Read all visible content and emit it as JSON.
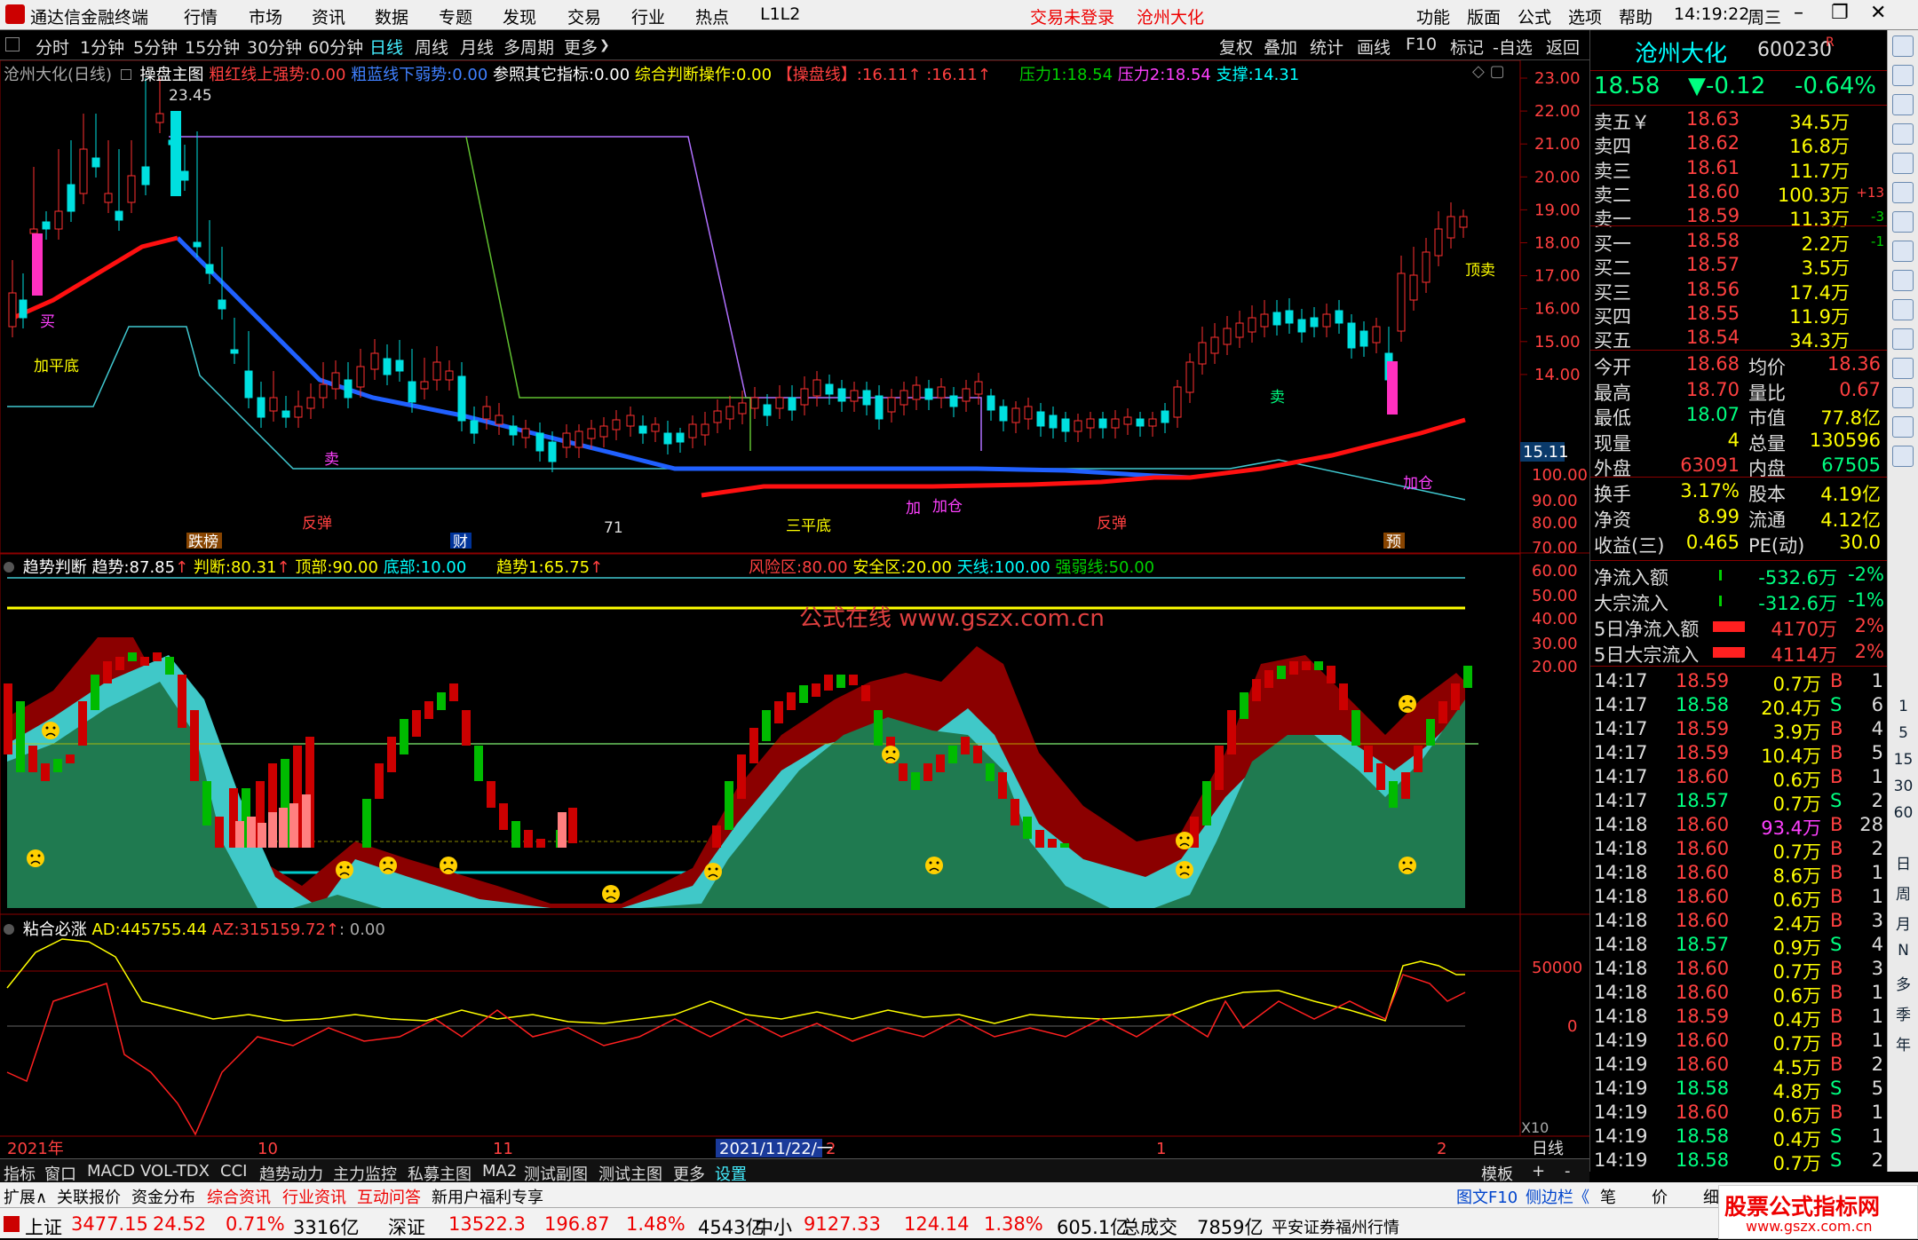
{
  "titlebar": {
    "app_name": "通达信金融终端",
    "menus": [
      "行情",
      "市场",
      "资讯",
      "数据",
      "专题",
      "发现",
      "交易",
      "行业",
      "热点",
      "L1L2"
    ],
    "login_status": "交易未登录",
    "stock_name": "沧州大化",
    "right_menus": [
      "功能",
      "版面",
      "公式",
      "选项",
      "帮助"
    ],
    "time": "14:19:22",
    "weekday": "周三"
  },
  "toolbar": {
    "periods": [
      "分时",
      "1分钟",
      "5分钟",
      "15分钟",
      "30分钟",
      "60分钟",
      "日线",
      "周线",
      "月线",
      "多周期",
      "更多"
    ],
    "active_period": "日线",
    "right_buttons": [
      "复权",
      "叠加",
      "统计",
      "画线",
      "F10",
      "标记",
      "-自选",
      "返回"
    ]
  },
  "main_chart": {
    "title": "沧州大化(日线)",
    "formula": "操盘主图",
    "ind1_label": "粗红线上强势:",
    "ind1_value": "0.00",
    "ind2_label": "粗蓝线下弱势:",
    "ind2_value": "0.00",
    "ind3_label": "参照其它指标:",
    "ind3_value": "0.00",
    "ind4_label": "综合判断操作:",
    "ind4_value": "0.00",
    "ind5_label": "【操盘线】:",
    "ind5_value": "16.11",
    "ind5_value2": "16.11",
    "pressure1_label": "压力1:",
    "pressure1_value": "18.54",
    "pressure2_label": "压力2:",
    "pressure2_value": "18.54",
    "support_label": "支撑:",
    "support_value": "14.31",
    "high_marker": "23.45",
    "price_axis": [
      "23.00",
      "22.00",
      "21.00",
      "20.00",
      "19.00",
      "18.00",
      "17.00",
      "16.00",
      "15.00",
      "14.00"
    ],
    "current_price_tag": "15.11",
    "annotations": {
      "buy": "买",
      "add_flat_bottom": "加平底",
      "rebound": "反弹",
      "sell": "卖",
      "three_flat_bottom": "三平底",
      "add": "加",
      "add_position": "加仓",
      "top_sell": "顶卖",
      "limit_down": "跌榜",
      "fortune": "财",
      "pre": "预",
      "low_marker": "71"
    }
  },
  "trend_panel": {
    "title": "趋势判断",
    "trend_label": "趋势:",
    "trend_value": "87.85",
    "judge_label": "判断:",
    "judge_value": "80.31",
    "top_label": "顶部:",
    "top_value": "90.00",
    "bottom_label": "底部:",
    "bottom_value": "10.00",
    "trend1_label": "趋势1:",
    "trend1_value": "65.75",
    "risk_label": "风险区:",
    "risk_value": "80.00",
    "safe_label": "安全区:",
    "safe_value": "20.00",
    "sky_label": "天线:",
    "sky_value": "100.00",
    "strength_label": "强弱线:",
    "strength_value": "50.00",
    "watermark": "公式在线  www.gszx.com.cn",
    "axis": [
      "100.00",
      "90.00",
      "80.00",
      "70.00",
      "60.00",
      "50.00",
      "40.00",
      "30.00",
      "20.00"
    ]
  },
  "bond_panel": {
    "title": "粘合必涨",
    "ad_label": "AD:",
    "ad_value": "445755.44",
    "az_label": "AZ:",
    "az_value": "315159.72",
    "extra_value": ": 0.00",
    "axis": [
      "50000",
      "0"
    ],
    "x10": "X10"
  },
  "date_axis": {
    "labels": [
      "2021年",
      "10",
      "11",
      "2021/11/22/一",
      "2",
      "1",
      "2"
    ],
    "period": "日线"
  },
  "bottom_tabs": [
    "指标",
    "窗口",
    "MACD",
    "VOL-TDX",
    "CCI",
    "趋势动力",
    "主力监控",
    "私募主图",
    "MA2",
    "测试副图",
    "测试主图",
    "更多",
    "设置"
  ],
  "bottom_right": [
    "模板",
    "+",
    "-"
  ],
  "ext_tabs": [
    "扩展∧",
    "关联报价",
    "资金分布",
    "综合资讯",
    "行业资讯",
    "互动问答",
    "新用户福利专享"
  ],
  "ext_right": [
    "图文F10",
    "侧边栏《"
  ],
  "ext_quote_tabs": [
    "笔",
    "价",
    "细"
  ],
  "quote": {
    "name": "沧州大化",
    "code": "600230",
    "r_mark": "R",
    "price": "18.58",
    "change": "▼-0.12",
    "change_pct": "-0.64%",
    "asks": [
      {
        "label": "卖五￥",
        "price": "18.63",
        "vol": "34.5万",
        "chg": ""
      },
      {
        "label": "卖四",
        "price": "18.62",
        "vol": "16.8万",
        "chg": ""
      },
      {
        "label": "卖三",
        "price": "18.61",
        "vol": "11.7万",
        "chg": ""
      },
      {
        "label": "卖二",
        "price": "18.60",
        "vol": "100.3万",
        "chg": "+13"
      },
      {
        "label": "卖一",
        "price": "18.59",
        "vol": "11.3万",
        "chg": "-3"
      }
    ],
    "bids": [
      {
        "label": "买一",
        "price": "18.58",
        "vol": "2.2万",
        "chg": "-1"
      },
      {
        "label": "买二",
        "price": "18.57",
        "vol": "3.5万",
        "chg": ""
      },
      {
        "label": "买三",
        "price": "18.56",
        "vol": "17.4万",
        "chg": ""
      },
      {
        "label": "买四",
        "price": "18.55",
        "vol": "11.9万",
        "chg": ""
      },
      {
        "label": "买五",
        "price": "18.54",
        "vol": "34.3万",
        "chg": ""
      }
    ],
    "stats": [
      {
        "l1": "今开",
        "v1": "18.68",
        "l2": "均价",
        "v2": "18.36"
      },
      {
        "l1": "最高",
        "v1": "18.70",
        "l2": "量比",
        "v2": "0.67"
      },
      {
        "l1": "最低",
        "v1": "18.07",
        "l2": "市值",
        "v2": "77.8亿"
      },
      {
        "l1": "现量",
        "v1": "4",
        "l2": "总量",
        "v2": "130596"
      },
      {
        "l1": "外盘",
        "v1": "63091",
        "l2": "内盘",
        "v2": "67505"
      }
    ],
    "fund": [
      {
        "l1": "换手",
        "v1": "3.17%",
        "l2": "股本",
        "v2": "4.19亿"
      },
      {
        "l1": "净资",
        "v1": "8.99",
        "l2": "流通",
        "v2": "4.12亿"
      },
      {
        "l1": "收益(三)",
        "v1": "0.465",
        "l2": "PE(动)",
        "v2": "30.0"
      }
    ],
    "flows": [
      {
        "label": "净流入额",
        "value": "-532.6万",
        "pct": "-2%"
      },
      {
        "label": "大宗流入",
        "value": "-312.6万",
        "pct": "-1%"
      },
      {
        "label": "5日净流入额",
        "value": "4170万",
        "pct": "2%"
      },
      {
        "label": "5日大宗流入",
        "value": "4114万",
        "pct": "2%"
      }
    ],
    "ticks": [
      {
        "t": "14:17",
        "p": "18.59",
        "v": "0.7万",
        "s": "B",
        "n": "1"
      },
      {
        "t": "14:17",
        "p": "18.58",
        "v": "20.4万",
        "s": "S",
        "n": "6"
      },
      {
        "t": "14:17",
        "p": "18.59",
        "v": "3.9万",
        "s": "B",
        "n": "4"
      },
      {
        "t": "14:17",
        "p": "18.59",
        "v": "10.4万",
        "s": "B",
        "n": "5"
      },
      {
        "t": "14:17",
        "p": "18.60",
        "v": "0.6万",
        "s": "B",
        "n": "1"
      },
      {
        "t": "14:17",
        "p": "18.57",
        "v": "0.7万",
        "s": "S",
        "n": "2"
      },
      {
        "t": "14:18",
        "p": "18.60",
        "v": "93.4万",
        "s": "B",
        "n": "28"
      },
      {
        "t": "14:18",
        "p": "18.60",
        "v": "0.7万",
        "s": "B",
        "n": "2"
      },
      {
        "t": "14:18",
        "p": "18.60",
        "v": "8.6万",
        "s": "B",
        "n": "1"
      },
      {
        "t": "14:18",
        "p": "18.60",
        "v": "0.6万",
        "s": "B",
        "n": "1"
      },
      {
        "t": "14:18",
        "p": "18.60",
        "v": "2.4万",
        "s": "B",
        "n": "3"
      },
      {
        "t": "14:18",
        "p": "18.57",
        "v": "0.9万",
        "s": "S",
        "n": "4"
      },
      {
        "t": "14:18",
        "p": "18.60",
        "v": "0.7万",
        "s": "B",
        "n": "3"
      },
      {
        "t": "14:18",
        "p": "18.60",
        "v": "0.6万",
        "s": "B",
        "n": "1"
      },
      {
        "t": "14:18",
        "p": "18.59",
        "v": "0.4万",
        "s": "B",
        "n": "1"
      },
      {
        "t": "14:19",
        "p": "18.60",
        "v": "0.7万",
        "s": "B",
        "n": "1"
      },
      {
        "t": "14:19",
        "p": "18.60",
        "v": "4.5万",
        "s": "B",
        "n": "2"
      },
      {
        "t": "14:19",
        "p": "18.58",
        "v": "4.8万",
        "s": "S",
        "n": "5"
      },
      {
        "t": "14:19",
        "p": "18.60",
        "v": "0.6万",
        "s": "B",
        "n": "1"
      },
      {
        "t": "14:19",
        "p": "18.58",
        "v": "0.4万",
        "s": "S",
        "n": "1"
      },
      {
        "t": "14:19",
        "p": "18.58",
        "v": "0.7万",
        "s": "S",
        "n": "2"
      }
    ]
  },
  "sidebar_text": [
    "日",
    "周",
    "月",
    "N",
    "多",
    "季",
    "年"
  ],
  "sidebar_nums": [
    "1",
    "5",
    "15",
    "30",
    "60"
  ],
  "statusbar": [
    {
      "name": "上证",
      "price": "3477.15",
      "chg": "24.52",
      "pct": "0.71%",
      "amt": "3316亿"
    },
    {
      "name": "深证",
      "price": "13522.3",
      "chg": "196.87",
      "pct": "1.48%",
      "amt": "4543亿"
    },
    {
      "name": "中小",
      "price": "9127.33",
      "chg": "124.14",
      "pct": "1.38%",
      "amt": "605.1亿"
    }
  ],
  "status_total_label": "总成交",
  "status_total": "7859亿",
  "status_broker": "平安证券福州行情",
  "logo_text": "股票公式指标网",
  "logo_url": "www.gszx.com.cn",
  "colors": {
    "up": "#ff3030",
    "down": "#00e0e0",
    "ma_red": "#ff1010",
    "ma_blue": "#2060ff",
    "bg": "#000000",
    "panel_green": "#1f7a50",
    "panel_cyan": "#40c8c8",
    "panel_darkred": "#8b0000"
  }
}
